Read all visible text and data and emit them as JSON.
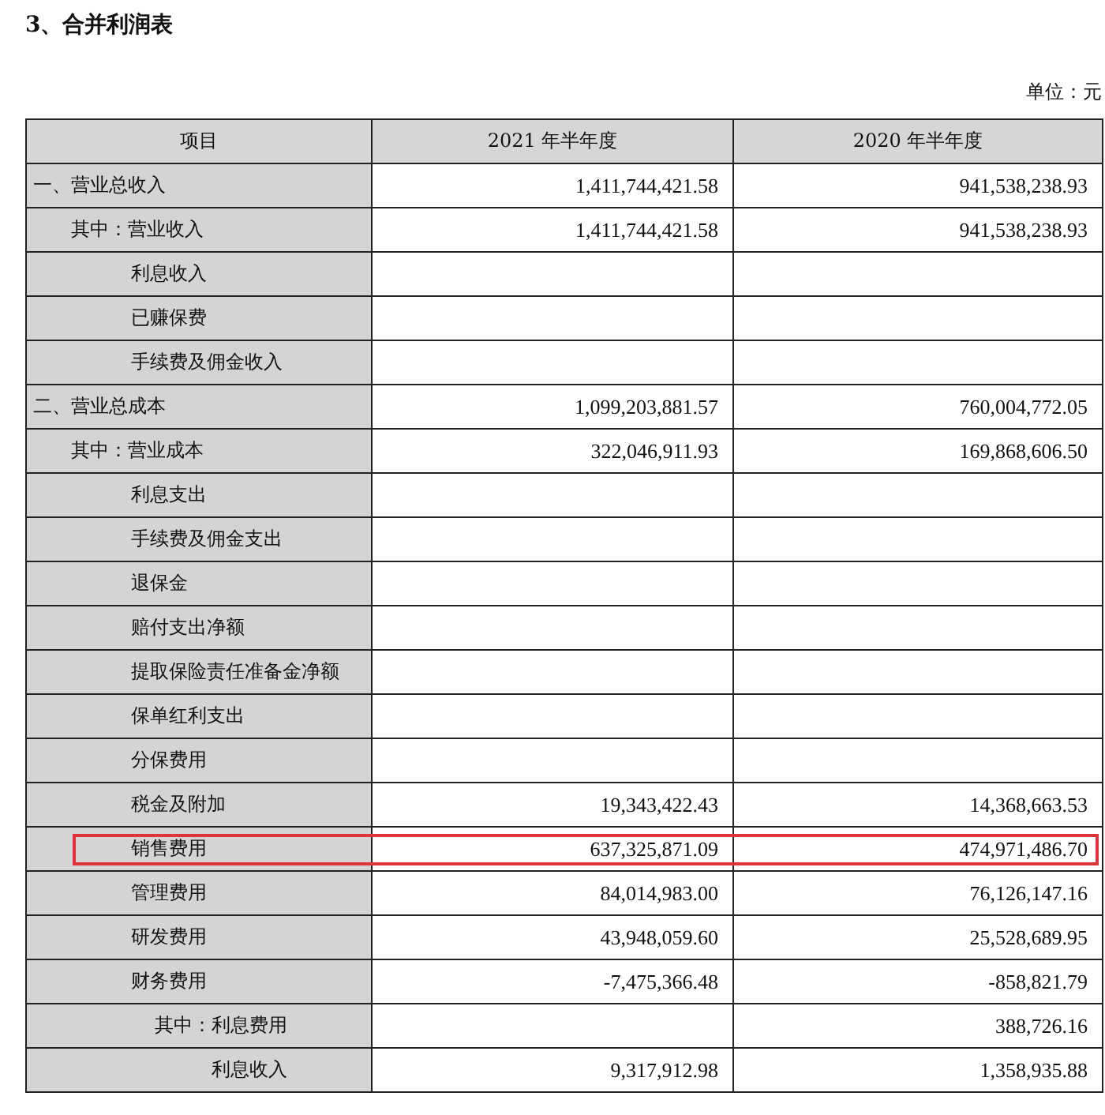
{
  "title": "3、合并利润表",
  "unit": "单位：元",
  "table": {
    "columns": [
      "项目",
      "2021 年半年度",
      "2020 年半年度"
    ],
    "rows": [
      {
        "label": "一、营业总收入",
        "current": "1,411,744,421.58",
        "prior": "941,538,238.93",
        "highlighted": false,
        "children": [
          {
            "label": "其中：营业收入",
            "current": "1,411,744,421.58",
            "prior": "941,538,238.93",
            "highlighted": false,
            "children": [
              {
                "label": "利息收入",
                "highlighted": false
              },
              {
                "label": "已赚保费",
                "highlighted": false
              },
              {
                "label": "手续费及佣金收入",
                "highlighted": false
              }
            ]
          }
        ]
      },
      {
        "label": "二、营业总成本",
        "current": "1,099,203,881.57",
        "prior": "760,004,772.05",
        "highlighted": false,
        "children": [
          {
            "label": "其中：营业成本",
            "current": "322,046,911.93",
            "prior": "169,868,606.50",
            "highlighted": false,
            "children": [
              {
                "label": "利息支出",
                "highlighted": false
              },
              {
                "label": "手续费及佣金支出",
                "highlighted": false
              },
              {
                "label": "退保金",
                "highlighted": false
              },
              {
                "label": "赔付支出净额",
                "highlighted": false
              },
              {
                "label": "提取保险责任准备金净额",
                "highlighted": false
              },
              {
                "label": "保单红利支出",
                "highlighted": false
              },
              {
                "label": "分保费用",
                "highlighted": false
              },
              {
                "label": "税金及附加",
                "current": "19,343,422.43",
                "prior": "14,368,663.53",
                "highlighted": false
              },
              {
                "label": "销售费用",
                "current": "637,325,871.09",
                "prior": "474,971,486.70",
                "highlighted": true
              },
              {
                "label": "管理费用",
                "current": "84,014,983.00",
                "prior": "76,126,147.16",
                "highlighted": false
              },
              {
                "label": "研发费用",
                "current": "43,948,059.60",
                "prior": "25,528,689.95",
                "highlighted": false
              },
              {
                "label": "财务费用",
                "current": "-7,475,366.48",
                "prior": "-858,821.79",
                "highlighted": false,
                "children": [
                  {
                    "label": "其中：利息费用",
                    "prior": "388,726.16",
                    "highlighted": false,
                    "children": [
                      {
                        "label": "利息收入",
                        "current": "9,317,912.98",
                        "prior": "1,358,935.88",
                        "highlighted": false
                      }
                    ]
                  }
                ]
              }
            ]
          }
        ]
      }
    ]
  }
}
